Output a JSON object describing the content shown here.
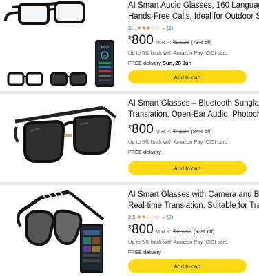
{
  "products": [
    {
      "title_line1": "AI Smart Audio Glasses, 160 Languages",
      "title_line2": "Hands-Free Calls, Ideal for Outdoor Spo",
      "rating": "3.1",
      "rating_stars": "★★★☆☆",
      "rating_count": "(2)",
      "price": "800",
      "currency": "₹",
      "mrp_label": "M.R.P:",
      "mrp": "₹2,920",
      "discount": "(73% off)",
      "cashback": "Up to 5% back with Amazon Pay ICICI card",
      "delivery_label": "FREE delivery",
      "delivery_date": "Sun, 28 Jun",
      "button": "Add to cart"
    },
    {
      "title_line1": "AI Smart Glasses – Bluetooth Sunglasse",
      "title_line2": "Translation, Open-Ear Audio, Photochro",
      "price": "800",
      "currency": "₹",
      "mrp_label": "M.R.P:",
      "mrp": "₹4,927",
      "discount": "(84% off)",
      "cashback": "Up to 5% back with Amazon Pay ICICI card",
      "delivery_label": "FREE delivery",
      "button": "Add to cart"
    },
    {
      "title_line1": "AI Smart Glasses with Camera and Blue",
      "title_line2": "Real-time Translation, Suitable for Trave",
      "rating": "2.5",
      "rating_stars": "★★☆☆☆",
      "rating_count": "(2)",
      "price": "800",
      "currency": "₹",
      "mrp_label": "M.R.P:",
      "mrp": "₹11,250",
      "discount": "(93% off)",
      "cashback": "Up to 5% back with Amazon Pay ICICI card",
      "delivery_label": "FREE delivery",
      "button": "Add to cart"
    }
  ],
  "phone_screen_text": {
    "time": "10:00",
    "label": "AI"
  },
  "colors": {
    "button": "#ffd814",
    "star": "#de7921",
    "link": "#007185",
    "muted": "#565959"
  }
}
